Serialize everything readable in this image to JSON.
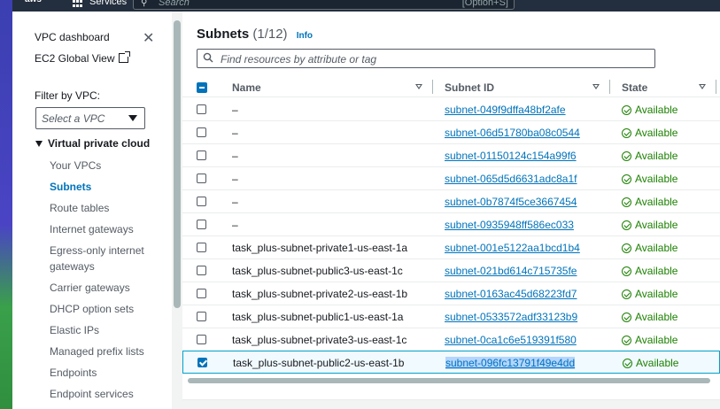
{
  "topbar": {
    "logo": "aws",
    "services_label": "Services",
    "search_placeholder": "Search",
    "search_shortcut": "[Option+S]"
  },
  "sidebar": {
    "dashboard": "VPC dashboard",
    "global_view": "EC2 Global View",
    "filter_label": "Filter by VPC:",
    "select_placeholder": "Select a VPC",
    "section": "Virtual private cloud",
    "items": [
      {
        "label": "Your VPCs",
        "active": false
      },
      {
        "label": "Subnets",
        "active": true
      },
      {
        "label": "Route tables",
        "active": false
      },
      {
        "label": "Internet gateways",
        "active": false
      },
      {
        "label": "Egress-only internet gateways",
        "active": false
      },
      {
        "label": "Carrier gateways",
        "active": false
      },
      {
        "label": "DHCP option sets",
        "active": false
      },
      {
        "label": "Elastic IPs",
        "active": false
      },
      {
        "label": "Managed prefix lists",
        "active": false
      },
      {
        "label": "Endpoints",
        "active": false
      },
      {
        "label": "Endpoint services",
        "active": false
      }
    ]
  },
  "main": {
    "title": "Subnets",
    "count": "(1/12)",
    "info": "Info",
    "find_placeholder": "Find resources by attribute or tag",
    "columns": [
      "Name",
      "Subnet ID",
      "State"
    ],
    "rows": [
      {
        "name": "–",
        "subnet_id": "subnet-049f9dffa48bf2afe",
        "state": "Available",
        "selected": false
      },
      {
        "name": "–",
        "subnet_id": "subnet-06d51780ba08c0544",
        "state": "Available",
        "selected": false
      },
      {
        "name": "–",
        "subnet_id": "subnet-01150124c154a99f6",
        "state": "Available",
        "selected": false
      },
      {
        "name": "–",
        "subnet_id": "subnet-065d5d6631adc8a1f",
        "state": "Available",
        "selected": false
      },
      {
        "name": "–",
        "subnet_id": "subnet-0b7874f5ce3667454",
        "state": "Available",
        "selected": false
      },
      {
        "name": "–",
        "subnet_id": "subnet-0935948ff586ec033",
        "state": "Available",
        "selected": false
      },
      {
        "name": "task_plus-subnet-private1-us-east-1a",
        "subnet_id": "subnet-001e5122aa1bcd1b4",
        "state": "Available",
        "selected": false
      },
      {
        "name": "task_plus-subnet-public3-us-east-1c",
        "subnet_id": "subnet-021bd614c715735fe",
        "state": "Available",
        "selected": false
      },
      {
        "name": "task_plus-subnet-private2-us-east-1b",
        "subnet_id": "subnet-0163ac45d68223fd7",
        "state": "Available",
        "selected": false
      },
      {
        "name": "task_plus-subnet-public1-us-east-1a",
        "subnet_id": "subnet-0533572adf33123b9",
        "state": "Available",
        "selected": false
      },
      {
        "name": "task_plus-subnet-private3-us-east-1c",
        "subnet_id": "subnet-0ca1c6e519391f580",
        "state": "Available",
        "selected": false
      },
      {
        "name": "task_plus-subnet-public2-us-east-1b",
        "subnet_id": "subnet-096fc13791f49e4dd",
        "state": "Available",
        "selected": true
      }
    ]
  },
  "colors": {
    "nav_bg": "#232f3e",
    "link": "#0073bb",
    "available": "#1d8102",
    "selected_row_bg": "#f1faff"
  }
}
